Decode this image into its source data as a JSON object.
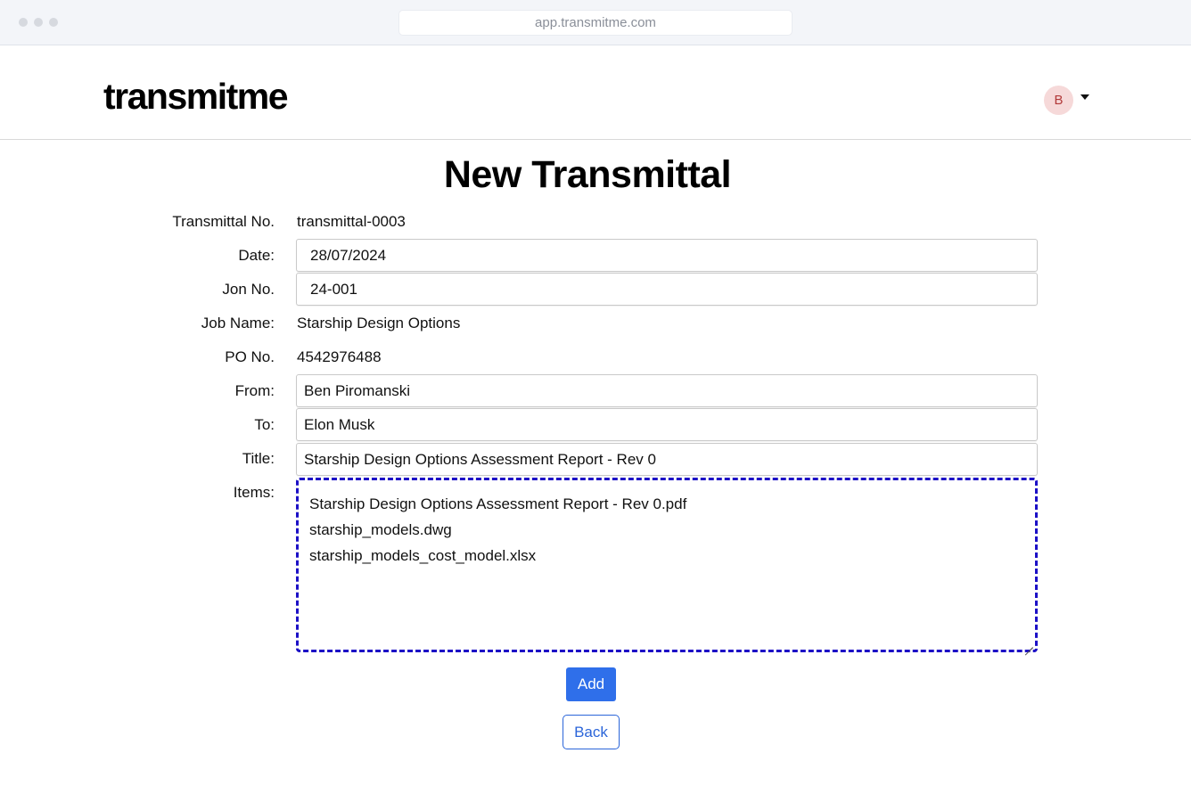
{
  "browser": {
    "url": "app.transmitme.com"
  },
  "header": {
    "logo": "transmitme",
    "avatar_initial": "B"
  },
  "page": {
    "title": "New Transmittal"
  },
  "form": {
    "transmittal_no": {
      "label": "Transmittal No.",
      "value": "transmittal-0003"
    },
    "date": {
      "label": "Date:",
      "value": "28/07/2024"
    },
    "job_no": {
      "label": "Jon No.",
      "value": "24-001"
    },
    "job_name": {
      "label": "Job Name:",
      "value": "Starship Design Options"
    },
    "po_no": {
      "label": "PO No.",
      "value": "4542976488"
    },
    "from": {
      "label": "From:",
      "value": "Ben Piromanski"
    },
    "to": {
      "label": "To:",
      "value": "Elon Musk"
    },
    "title": {
      "label": "Title:",
      "value": "Starship Design Options Assessment Report - Rev 0"
    },
    "items": {
      "label": "Items:",
      "list": [
        "Starship Design Options Assessment Report - Rev 0.pdf",
        "starship_models.dwg",
        "starship_models_cost_model.xlsx"
      ]
    }
  },
  "actions": {
    "add_label": "Add",
    "back_label": "Back"
  },
  "colors": {
    "primary": "#2f6fea",
    "dashed_border": "#1c10c6",
    "avatar_bg": "#f6d9d9"
  }
}
